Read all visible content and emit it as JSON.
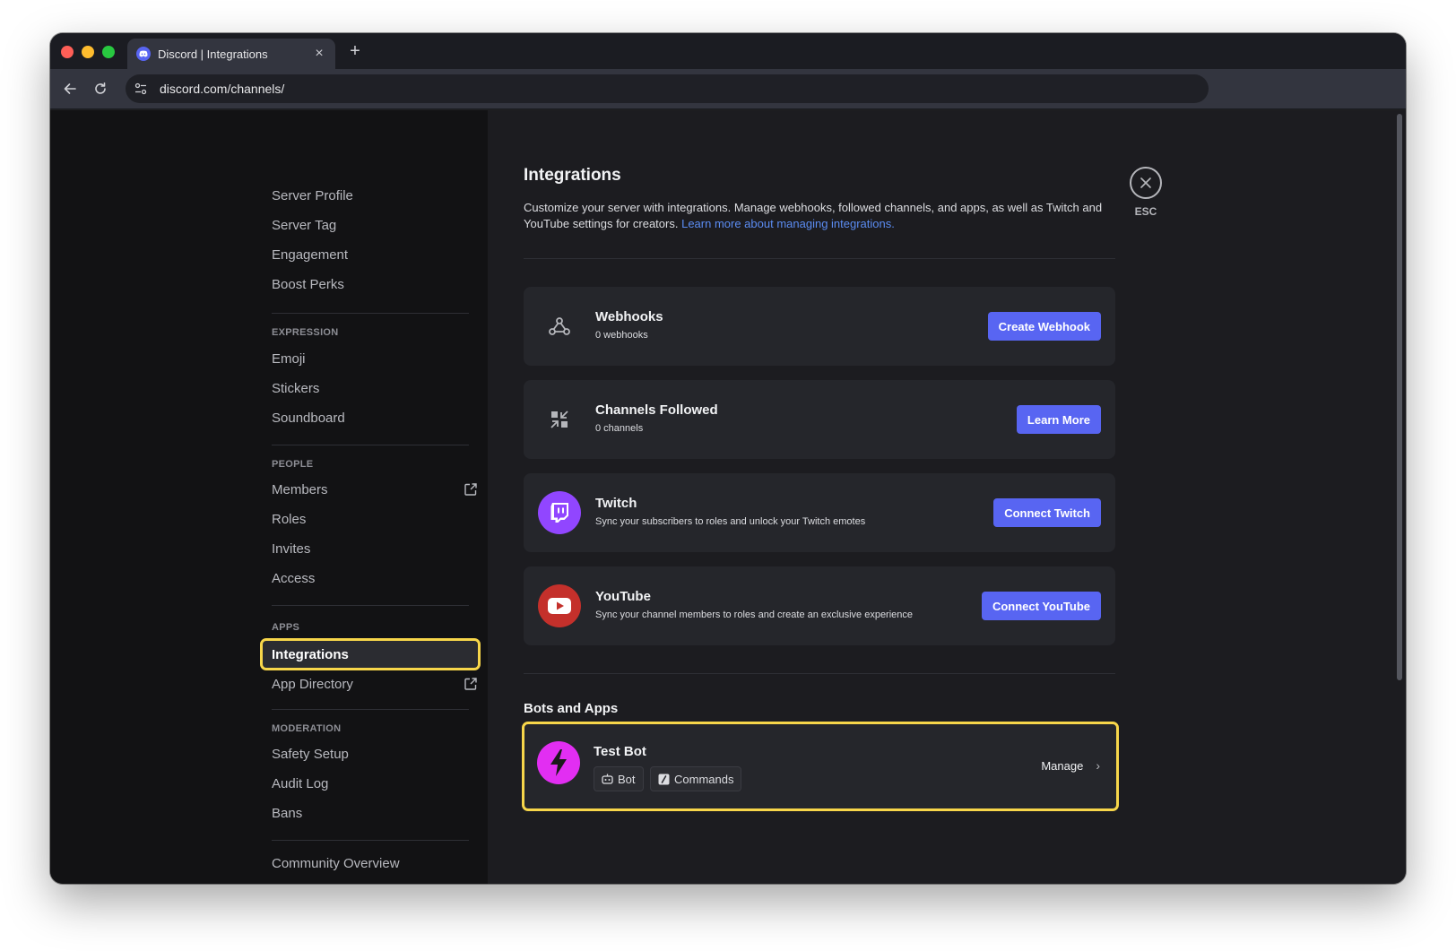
{
  "browser": {
    "tab_title": "Discord | Integrations",
    "url": "discord.com/channels/"
  },
  "sidebar": {
    "groups": [
      {
        "header": "",
        "items": [
          {
            "label": "Server Profile"
          },
          {
            "label": "Server Tag"
          },
          {
            "label": "Engagement"
          },
          {
            "label": "Boost Perks"
          }
        ]
      },
      {
        "header": "EXPRESSION",
        "items": [
          {
            "label": "Emoji"
          },
          {
            "label": "Stickers"
          },
          {
            "label": "Soundboard"
          }
        ]
      },
      {
        "header": "PEOPLE",
        "items": [
          {
            "label": "Members",
            "external": true
          },
          {
            "label": "Roles"
          },
          {
            "label": "Invites"
          },
          {
            "label": "Access"
          }
        ]
      },
      {
        "header": "APPS",
        "items": [
          {
            "label": "Integrations",
            "active": true
          },
          {
            "label": "App Directory",
            "external": true
          }
        ]
      },
      {
        "header": "MODERATION",
        "items": [
          {
            "label": "Safety Setup"
          },
          {
            "label": "Audit Log"
          },
          {
            "label": "Bans"
          }
        ]
      },
      {
        "header": "",
        "items": [
          {
            "label": "Community Overview"
          }
        ]
      }
    ]
  },
  "main": {
    "title": "Integrations",
    "description": "Customize your server with integrations. Manage webhooks, followed channels, and apps, as well as Twitch and YouTube settings for creators.",
    "description_link": "Learn more about managing integrations.",
    "close_label": "ESC",
    "cards": [
      {
        "title": "Webhooks",
        "subtitle": "0 webhooks",
        "button": "Create Webhook",
        "icon": "webhook-icon"
      },
      {
        "title": "Channels Followed",
        "subtitle": "0 channels",
        "button": "Learn More",
        "icon": "channels-followed-icon"
      },
      {
        "title": "Twitch",
        "subtitle": "Sync your subscribers to roles and unlock your Twitch emotes",
        "button": "Connect Twitch",
        "icon": "twitch-icon"
      },
      {
        "title": "YouTube",
        "subtitle": "Sync your channel members to roles and create an exclusive experience",
        "button": "Connect YouTube",
        "icon": "youtube-icon"
      }
    ],
    "bots_section_title": "Bots and Apps",
    "bot": {
      "name": "Test Bot",
      "tags": [
        "Bot",
        "Commands"
      ],
      "manage_label": "Manage"
    }
  },
  "colors": {
    "accent": "#5865f2",
    "highlight": "#f7d64a",
    "twitch": "#9146ff",
    "youtube": "#c4302b",
    "bot_avatar": "#e22ef2"
  }
}
